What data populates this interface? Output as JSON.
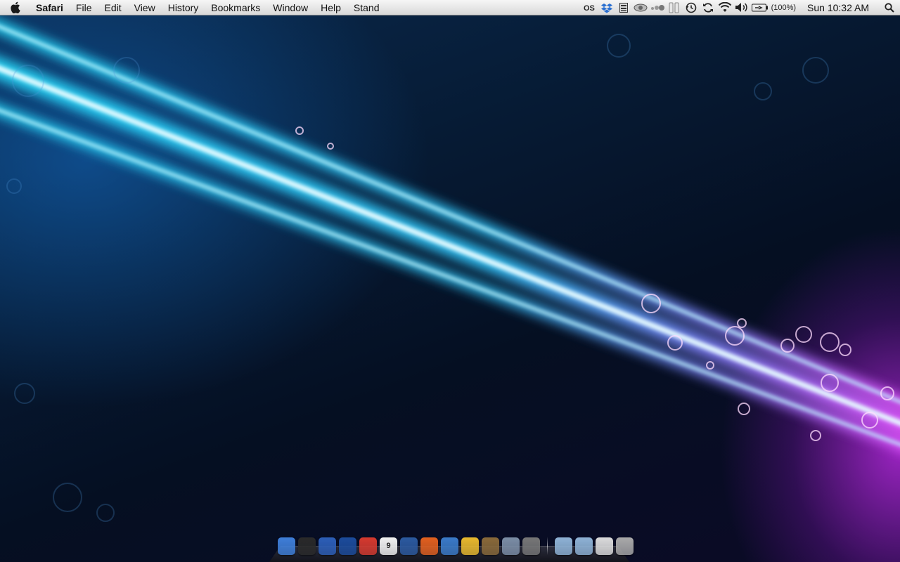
{
  "menubar": {
    "app_name": "Safari",
    "menus": [
      "File",
      "Edit",
      "View",
      "History",
      "Bookmarks",
      "Window",
      "Help",
      "Stand"
    ],
    "status_icons": [
      "lastfm-icon",
      "dropbox-icon",
      "istat-icon",
      "eye-icon",
      "growl-icon",
      "bars-icon",
      "time-machine-icon",
      "sync-icon",
      "wifi-icon",
      "volume-icon",
      "battery-icon"
    ],
    "battery_text": "(100%)",
    "clock": "Sun 10:32 AM"
  },
  "dock": {
    "apps": [
      {
        "name": "finder",
        "color": "#3f7fd9"
      },
      {
        "name": "dashboard",
        "color": "#2a2a2a"
      },
      {
        "name": "preview-blue",
        "color": "#2d5fb8"
      },
      {
        "name": "obama",
        "color": "#1c4c9c"
      },
      {
        "name": "gmail",
        "color": "#d63a2f"
      },
      {
        "name": "calendar",
        "color": "#f2f2f2",
        "label": "9"
      },
      {
        "name": "things",
        "color": "#2c5aa0"
      },
      {
        "name": "flower-app",
        "color": "#e2601f"
      },
      {
        "name": "globe-app",
        "color": "#3b7bc9"
      },
      {
        "name": "stickies",
        "color": "#e8b92e"
      },
      {
        "name": "photo-app",
        "color": "#8a6a3a"
      },
      {
        "name": "preview",
        "color": "#7c8ea6"
      },
      {
        "name": "system-preferences",
        "color": "#777777"
      }
    ],
    "stacks": [
      {
        "name": "applications-folder",
        "color": "#8fb3d6"
      },
      {
        "name": "downloads-folder",
        "color": "#8fb3d6"
      },
      {
        "name": "documents-stack",
        "color": "#dcdcdc"
      },
      {
        "name": "trash",
        "color": "#aaaaaa"
      }
    ]
  }
}
